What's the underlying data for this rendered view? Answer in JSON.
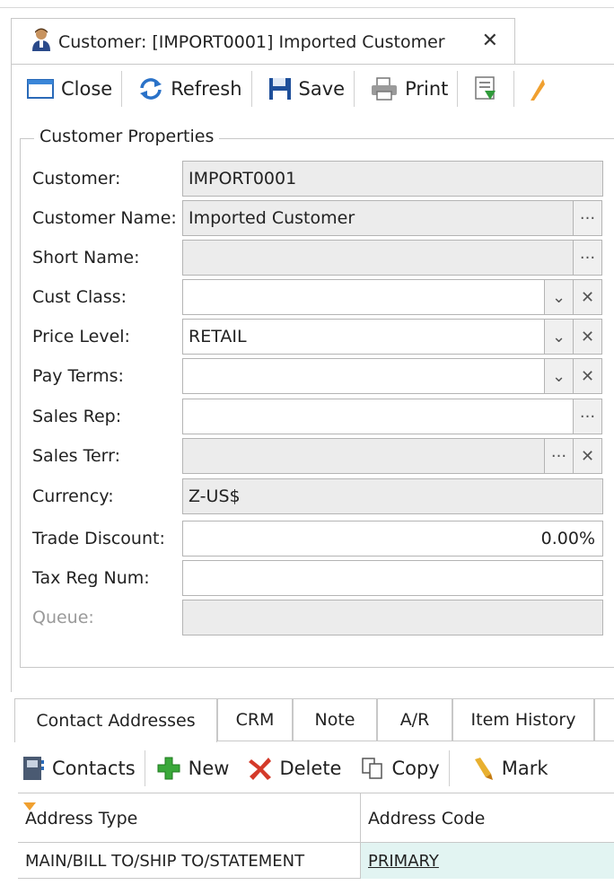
{
  "document_tab": {
    "title": "Customer: [IMPORT0001] Imported Customer",
    "icon": "user-icon",
    "close_glyph": "✕"
  },
  "toolbar": {
    "items": [
      {
        "label": "Close",
        "icon": "window-close-icon"
      },
      {
        "label": "Refresh",
        "icon": "refresh-icon"
      },
      {
        "label": "Save",
        "icon": "floppy-save-icon"
      },
      {
        "label": "Print",
        "icon": "printer-icon"
      },
      {
        "label": "",
        "icon": "export-report-icon"
      }
    ]
  },
  "group": {
    "title": "Customer Properties"
  },
  "fields": {
    "customer": {
      "label": "Customer:",
      "value": "IMPORT0001"
    },
    "customer_name": {
      "label": "Customer Name:",
      "value": "Imported Customer"
    },
    "short_name": {
      "label": "Short Name:",
      "value": ""
    },
    "cust_class": {
      "label": "Cust Class:",
      "value": ""
    },
    "price_level": {
      "label": "Price Level:",
      "value": "RETAIL"
    },
    "pay_terms": {
      "label": "Pay Terms:",
      "value": ""
    },
    "sales_rep": {
      "label": "Sales Rep:",
      "value": ""
    },
    "sales_terr": {
      "label": "Sales Terr:",
      "value": ""
    },
    "currency": {
      "label": "Currency:",
      "value": "Z-US$"
    },
    "trade_discount": {
      "label": "Trade Discount:",
      "value": "0.00%"
    },
    "tax_reg_num": {
      "label": "Tax Reg Num:",
      "value": ""
    },
    "queue": {
      "label": "Queue:",
      "value": ""
    }
  },
  "glyphs": {
    "ellipsis": "···",
    "dropdown": "⌄",
    "clear": "✕"
  },
  "bottom_tabs": [
    "Contact Addresses",
    "CRM",
    "Note",
    "A/R",
    "Item History"
  ],
  "address_toolbar": {
    "items": [
      {
        "label": "Contacts",
        "icon": "contacts-book-icon"
      },
      {
        "label": "New",
        "icon": "plus-icon"
      },
      {
        "label": "Delete",
        "icon": "delete-x-icon"
      },
      {
        "label": "Copy",
        "icon": "copy-icon"
      },
      {
        "label": "Mark",
        "icon": "marker-icon"
      }
    ]
  },
  "address_grid": {
    "columns": [
      "Address Type",
      "Address Code"
    ],
    "rows": [
      {
        "address_type": "MAIN/BILL TO/SHIP TO/STATEMENT",
        "address_code": "PRIMARY"
      }
    ]
  },
  "colors": {
    "selected_cell_bg": "#e2f4f2",
    "readonly_bg": "#ececec",
    "border": "#b4b4b4",
    "accent_orange": "#f0a030",
    "green_plus": "#3aa83a",
    "red_delete": "#d43a2a"
  }
}
